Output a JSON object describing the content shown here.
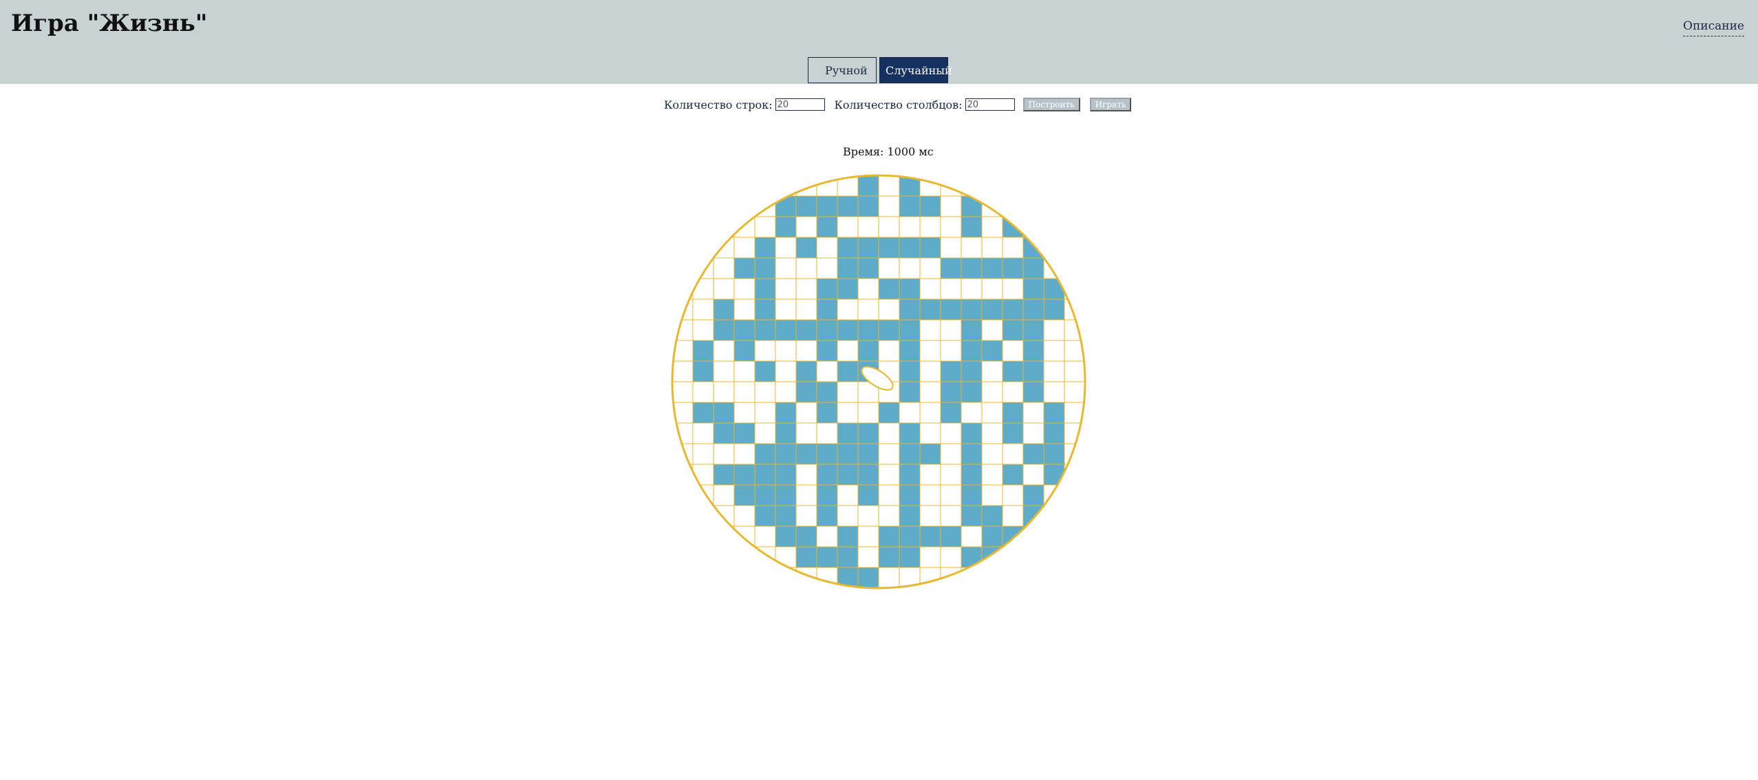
{
  "header": {
    "title": "Игра \"Жизнь\"",
    "description_link": "Описание"
  },
  "tabs": {
    "manual": "Ручной",
    "random": "Случайный",
    "active": "random"
  },
  "controls": {
    "rows_label": "Количество строк:",
    "rows_value": "20",
    "cols_label": "Количество столбцов:",
    "cols_value": "20",
    "build_label": "Построить",
    "play_label": "Играть"
  },
  "timer": {
    "text": "Время: 1000 мс"
  },
  "board": {
    "rows": 20,
    "cols": 20,
    "shape": "circle",
    "alive_color": "#5eacca",
    "dead_color": "#ffffff",
    "grid_color": "#e8b830",
    "cells": [
      "00000000010100000000",
      "00000111110110100000",
      "00000101000000101000",
      "00001010111110000100",
      "00011000110001111100",
      "00001001101100000110",
      "00101001000111111110",
      "00111111111100101100",
      "01010001010100110100",
      "01001010110101101100",
      "00000011000101100100",
      "01100101001001001010",
      "00110100110100101010",
      "00001111110110100110",
      "00111101110100101010",
      "00011101010100100100",
      "00001101000100110110",
      "00000110101111011100",
      "00000011101100111000",
      "00000000110000000000"
    ]
  }
}
